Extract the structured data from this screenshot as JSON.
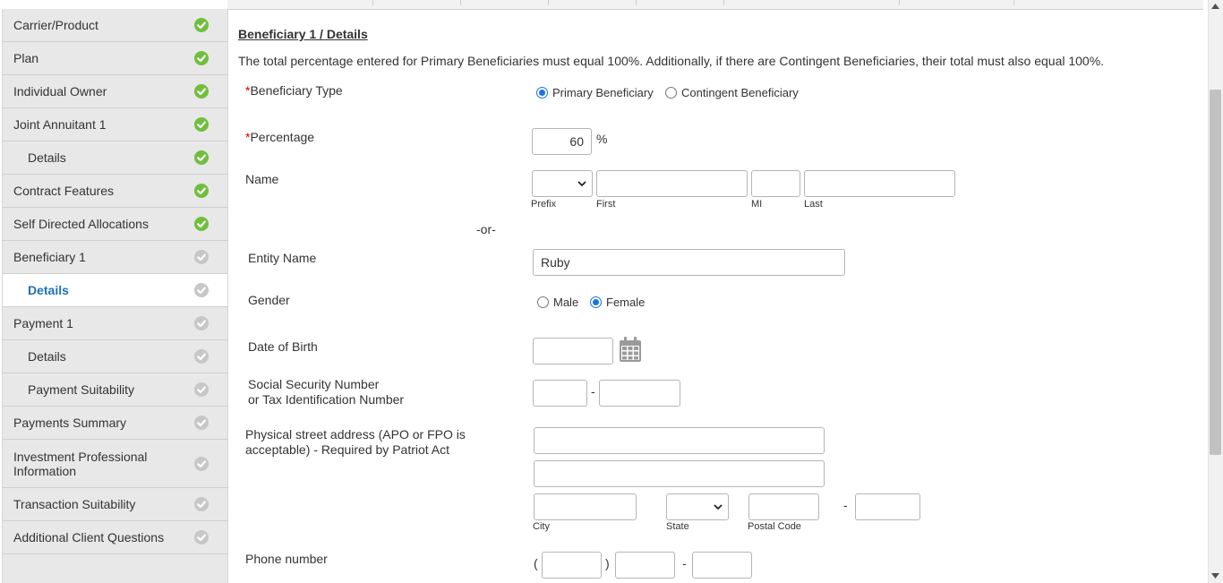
{
  "sidebar": {
    "items": [
      {
        "label": "Carrier/Product",
        "status": "complete"
      },
      {
        "label": "Plan",
        "status": "complete"
      },
      {
        "label": "Individual Owner",
        "status": "complete"
      },
      {
        "label": "Joint Annuitant 1",
        "status": "complete"
      },
      {
        "label": "Details",
        "status": "complete"
      },
      {
        "label": "Contract Features",
        "status": "complete"
      },
      {
        "label": "Self Directed Allocations",
        "status": "complete"
      },
      {
        "label": "Beneficiary 1",
        "status": "incomplete"
      },
      {
        "label": "Details",
        "status": "incomplete",
        "active": true
      },
      {
        "label": "Payment 1",
        "status": "incomplete"
      },
      {
        "label": "Details",
        "status": "incomplete"
      },
      {
        "label": "Payment Suitability",
        "status": "incomplete"
      },
      {
        "label": "Payments Summary",
        "status": "incomplete"
      },
      {
        "label": "Investment Professional Information",
        "status": "incomplete"
      },
      {
        "label": "Transaction Suitability",
        "status": "incomplete"
      },
      {
        "label": "Additional Client Questions",
        "status": "incomplete"
      }
    ],
    "check_icon": "check-circle-icon"
  },
  "form": {
    "title": "Beneficiary 1 / Details",
    "intro": "The total percentage entered for Primary Beneficiaries must equal 100%. Additionally, if there are Contingent Beneficiaries, their total must also equal 100%.",
    "required_marker": "*",
    "beneficiary_type": {
      "label": "Beneficiary Type",
      "options": [
        "Primary Beneficiary",
        "Contingent Beneficiary"
      ],
      "selected": "Primary Beneficiary"
    },
    "percentage": {
      "label": "Percentage",
      "value": "60",
      "unit": "%"
    },
    "name": {
      "label": "Name",
      "prefix_caption": "Prefix",
      "first_caption": "First",
      "mi_caption": "MI",
      "last_caption": "Last",
      "prefix_value": "",
      "first_value": "",
      "mi_value": "",
      "last_value": ""
    },
    "or_text": "-or-",
    "entity_name": {
      "label": "Entity Name",
      "value": "Ruby"
    },
    "gender": {
      "label": "Gender",
      "options": [
        "Male",
        "Female"
      ],
      "selected": "Female"
    },
    "dob": {
      "label": "Date of Birth",
      "value": "",
      "icon": "calendar-icon"
    },
    "ssn": {
      "label_line1": "Social Security Number",
      "label_line2": "or Tax Identification Number",
      "part1": "",
      "part2": "",
      "separator": "-"
    },
    "address": {
      "label_line1": "Physical street address (APO or FPO is",
      "label_line2": "acceptable) - Required by Patriot Act",
      "line1": "",
      "line2": "",
      "city_caption": "City",
      "state_caption": "State",
      "postal_caption": "Postal Code",
      "city": "",
      "postal": "",
      "postal_ext": "",
      "separator": "-"
    },
    "phone": {
      "label": "Phone number",
      "open_paren": "(",
      "close_paren": ")",
      "separator": "-",
      "area": "",
      "prefix": "",
      "line": ""
    }
  },
  "colors": {
    "complete": "#6fbf3c",
    "incomplete": "#c7c7c7",
    "active_text": "#1e72b8",
    "required": "#cc0000"
  }
}
